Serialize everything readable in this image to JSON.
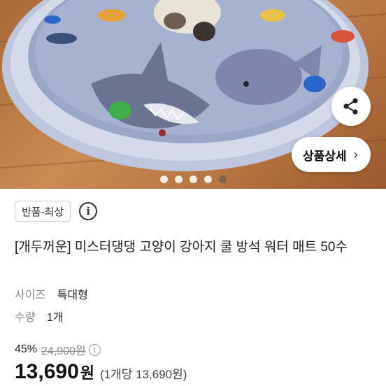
{
  "hero": {
    "image_alt": "shark-themed water mat with cat",
    "share_icon": "share-icon",
    "detail_button_label": "상품상세",
    "detail_chevron": "›",
    "pagination": {
      "count": 5,
      "active_index": 4
    }
  },
  "product": {
    "badge": "반품-최상",
    "title": "[개두꺼운] 미스터댕댕 고양이 강아지 쿨 방석 워터 매트 50수",
    "options": [
      {
        "key": "사이즈",
        "value": "특대형"
      },
      {
        "key": "수량",
        "value": "1개"
      }
    ],
    "pricing": {
      "discount": "45%",
      "original_price": "24,900원",
      "price": "13,690",
      "currency": "원",
      "unit_price": "(1개당 13,690원)"
    }
  },
  "colors": {
    "background": "#ffffff",
    "text": "#222222",
    "muted": "#888888"
  }
}
